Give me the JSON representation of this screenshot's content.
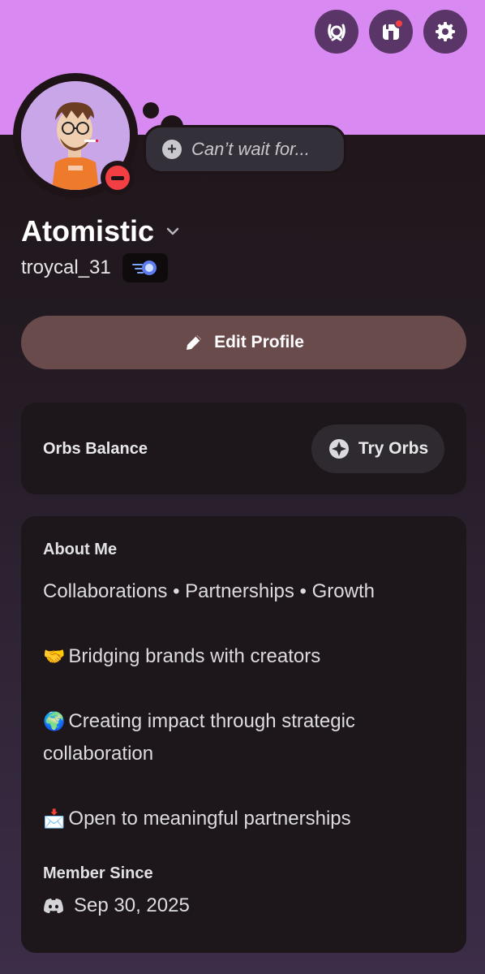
{
  "header": {
    "icons": [
      "nitro-laurel-icon",
      "shop-icon",
      "settings-gear-icon"
    ],
    "shop_has_notification": true,
    "banner_color": "#d98af2"
  },
  "profile": {
    "status": "do-not-disturb",
    "status_color": "#f23f43",
    "custom_status_placeholder": "Can’t wait for...",
    "display_name": "Atomistic",
    "username": "troycal_31",
    "badge_icon": "speed-orb-badge-icon"
  },
  "actions": {
    "edit_profile_label": "Edit Profile"
  },
  "orbs": {
    "label": "Orbs Balance",
    "button_label": "Try Orbs"
  },
  "about": {
    "title": "About Me",
    "lines": [
      "Collaborations • Partnerships • Growth",
      "Bridging brands with creators",
      "Creating impact through strategic collaboration",
      "Open to meaningful partnerships"
    ],
    "emojis": [
      "🤝",
      "🌍",
      "📩"
    ],
    "member_since_title": "Member Since",
    "member_since_date": "Sep 30, 2025"
  }
}
